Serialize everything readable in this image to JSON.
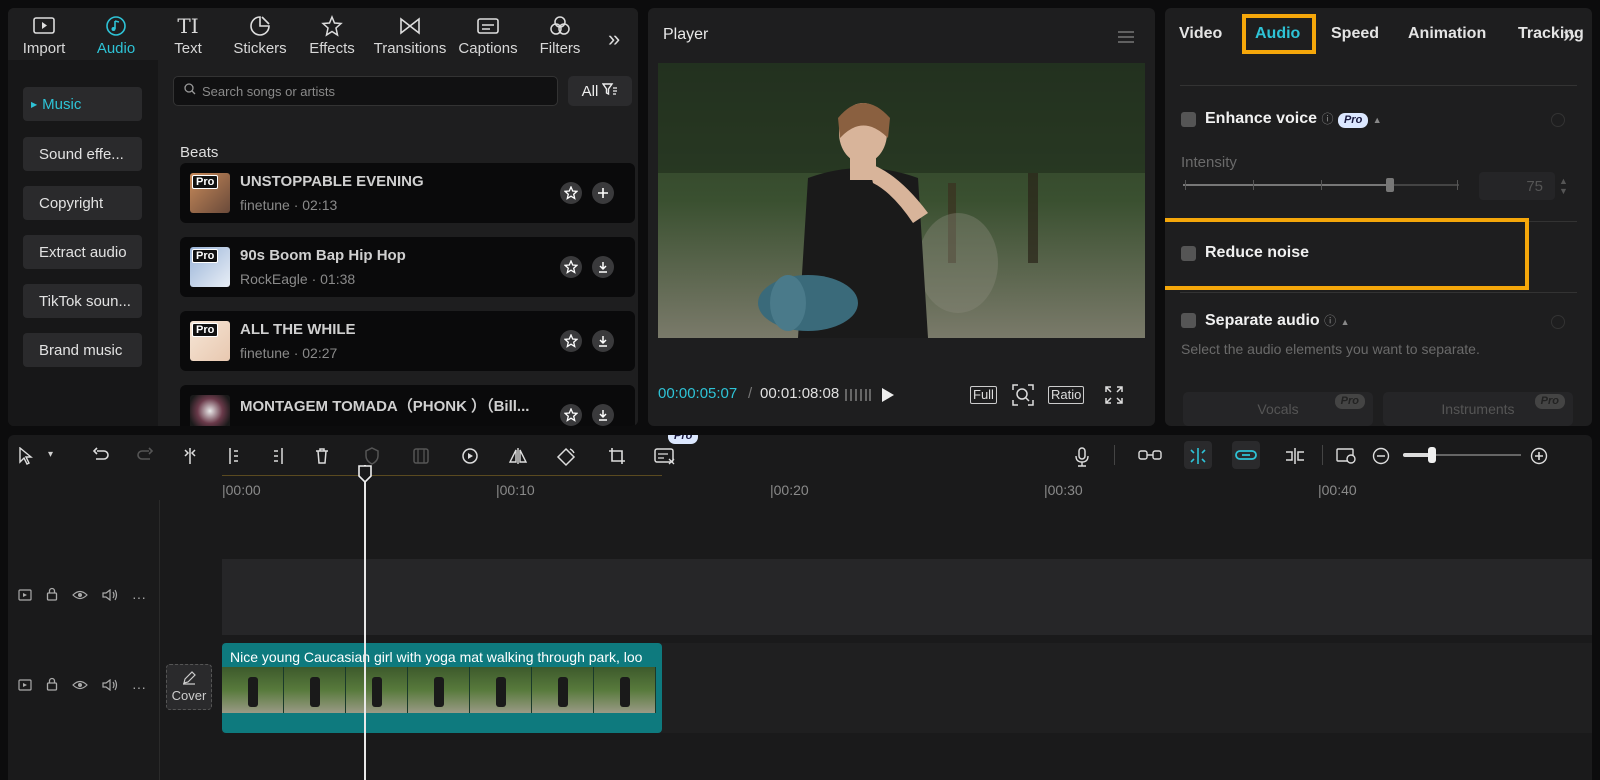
{
  "categories": [
    {
      "label": "Import",
      "icon": "import-icon"
    },
    {
      "label": "Audio",
      "icon": "music-note-icon",
      "active": true
    },
    {
      "label": "Text",
      "icon": "text-icon"
    },
    {
      "label": "Stickers",
      "icon": "sticker-icon"
    },
    {
      "label": "Effects",
      "icon": "effects-star-icon"
    },
    {
      "label": "Transitions",
      "icon": "transition-icon"
    },
    {
      "label": "Captions",
      "icon": "captions-icon"
    },
    {
      "label": "Filters",
      "icon": "filters-icon"
    }
  ],
  "sidebar": {
    "items": [
      {
        "label": "Music",
        "active": true
      },
      {
        "label": "Sound effe..."
      },
      {
        "label": "Copyright"
      },
      {
        "label": "Extract audio"
      },
      {
        "label": "TikTok soun..."
      },
      {
        "label": "Brand music"
      }
    ]
  },
  "search": {
    "placeholder": "Search songs or artists"
  },
  "filter": {
    "label": "All"
  },
  "library": {
    "section": "Beats",
    "tracks": [
      {
        "title": "UNSTOPPABLE EVENING",
        "meta": "finetune · 02:13",
        "badge": "Pro",
        "action": "add"
      },
      {
        "title": "90s Boom Bap Hip Hop",
        "meta": "RockEagle · 01:38",
        "badge": "Pro",
        "action": "download"
      },
      {
        "title": "ALL THE WHILE",
        "meta": "finetune · 02:27",
        "badge": "Pro",
        "action": "download"
      },
      {
        "title": "MONTAGEM TOMADA（PHONK ）（Bill...",
        "meta": "",
        "badge": "",
        "action": "download"
      }
    ]
  },
  "player": {
    "title": "Player",
    "current_time": "00:00:05:07",
    "separator": "/",
    "total_time": "00:01:08:08",
    "full_label": "Full",
    "ratio_label": "Ratio"
  },
  "properties": {
    "tabs": [
      "Video",
      "Audio",
      "Speed",
      "Animation",
      "Tracking"
    ],
    "active_tab": "Audio",
    "enhance_voice": {
      "label": "Enhance voice",
      "badge": "Pro",
      "intensity_label": "Intensity",
      "intensity_value": "75",
      "intensity": 0.75
    },
    "reduce_noise": {
      "label": "Reduce noise"
    },
    "separate_audio": {
      "label": "Separate audio",
      "description": "Select the audio elements you want to separate.",
      "vocals_label": "Vocals",
      "instruments_label": "Instruments",
      "badge": "Pro"
    }
  },
  "timeline": {
    "ruler": [
      "00:00",
      "00:10",
      "00:20",
      "00:30",
      "00:40"
    ],
    "clip_title": "Nice young Caucasian girl with yoga mat walking through park, loo",
    "cover_label": "Cover",
    "tool_badge": "Pro"
  },
  "colors": {
    "accent": "#2ec3d6",
    "highlight": "#f5a70a",
    "clip": "#0e7a7e"
  }
}
